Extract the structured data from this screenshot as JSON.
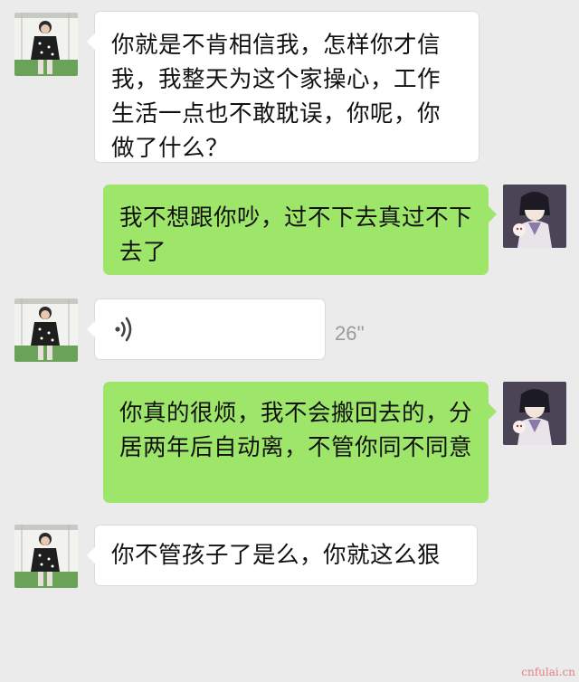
{
  "messages": [
    {
      "side": "in",
      "text": "你就是不肯相信我，怎样你才信我，我整天为这个家操心，工作生活一点也不敢耽误，你呢，你做了什么？"
    },
    {
      "side": "out",
      "text": "我不想跟你吵，过不下去真过不下去了"
    },
    {
      "side": "in",
      "type": "voice",
      "duration": "26''"
    },
    {
      "side": "out",
      "text": "你真的很烦，我不会搬回去的，分居两年后自动离，不管你同不同意"
    },
    {
      "side": "in",
      "text": "你不管孩子了是么，你就这么狠"
    }
  ],
  "watermark": "cnfulai.cn",
  "colors": {
    "background": "#ebebeb",
    "incoming_bubble": "#ffffff",
    "outgoing_bubble": "#9ee66a"
  }
}
